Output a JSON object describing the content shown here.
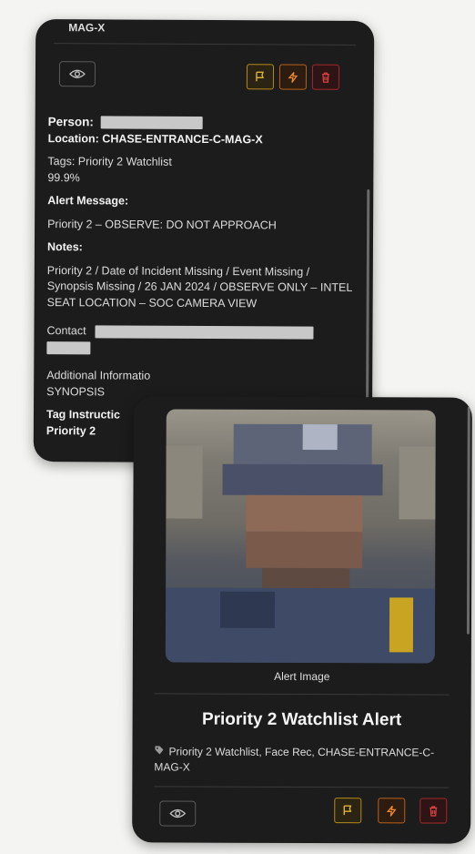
{
  "back_card": {
    "top_fragment": "MAG-X",
    "person_label": "Person:",
    "location_label": "Location:",
    "location_value": "CHASE-ENTRANCE-C-MAG-X",
    "tags_line": "Tags: Priority 2 Watchlist",
    "confidence": "99.9%",
    "alert_message_label": "Alert Message:",
    "alert_message": "Priority 2 – OBSERVE: DO NOT APPROACH",
    "notes_label": "Notes:",
    "notes": "Priority 2 / Date of Incident Missing / Event Missing / Synopsis Missing / 26 JAN 2024 / OBSERVE ONLY – INTEL SEAT LOCATION – SOC CAMERA VIEW",
    "contact_label": "Contact",
    "additional_label": "Additional Informatio",
    "additional_value": "SYNOPSIS",
    "tag_instructions_label": "Tag Instructic",
    "tag_instructions_value": "Priority 2"
  },
  "front_card": {
    "image_caption": "Alert Image",
    "title": "Priority 2 Watchlist Alert",
    "tags": "Priority 2 Watchlist, Face Rec, CHASE-ENTRANCE-C-MAG-X"
  },
  "icons": {
    "view": "eye-icon",
    "flag": "flag-icon",
    "escalate": "lightning-icon",
    "delete": "trash-icon",
    "tag": "tag-icon"
  },
  "colors": {
    "card_bg": "#1c1c1c",
    "flag": "#e1b339",
    "bolt": "#f08a2a",
    "trash": "#e04545"
  }
}
